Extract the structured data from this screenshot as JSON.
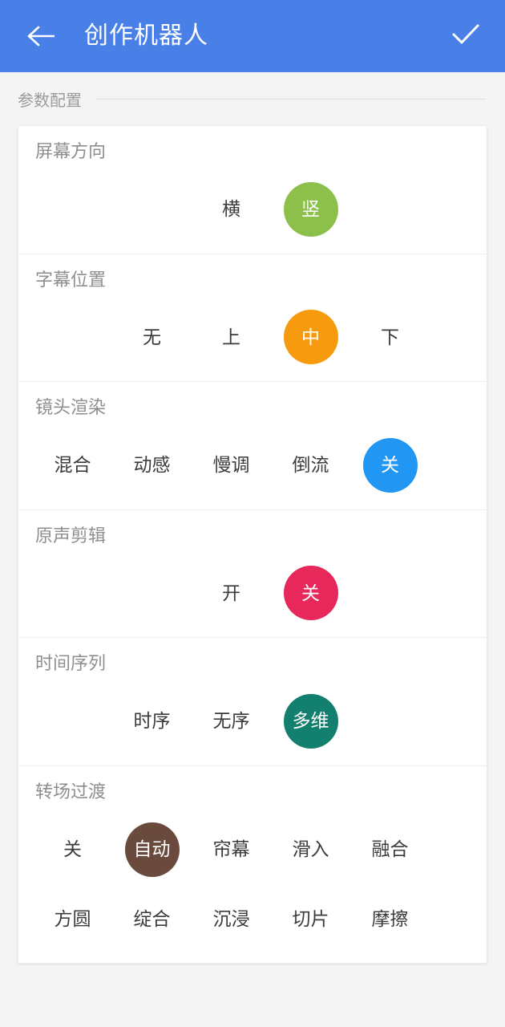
{
  "header": {
    "back_icon": "arrow-left-icon",
    "title": "创作机器人",
    "confirm_icon": "check-icon",
    "background": "#4880e8"
  },
  "group": {
    "label": "参数配置"
  },
  "sections": [
    {
      "title": "屏幕方向",
      "leading_blanks": 2,
      "color": "#8cc04a",
      "options": [
        {
          "label": "横",
          "selected": false
        },
        {
          "label": "竖",
          "selected": true
        }
      ]
    },
    {
      "title": "字幕位置",
      "leading_blanks": 1,
      "color": "#f89a0e",
      "options": [
        {
          "label": "无",
          "selected": false
        },
        {
          "label": "上",
          "selected": false
        },
        {
          "label": "中",
          "selected": true
        },
        {
          "label": "下",
          "selected": false
        }
      ]
    },
    {
      "title": "镜头渲染",
      "leading_blanks": 0,
      "color": "#2196f3",
      "options": [
        {
          "label": "混合",
          "selected": false
        },
        {
          "label": "动感",
          "selected": false
        },
        {
          "label": "慢调",
          "selected": false
        },
        {
          "label": "倒流",
          "selected": false
        },
        {
          "label": "关",
          "selected": true
        }
      ]
    },
    {
      "title": "原声剪辑",
      "leading_blanks": 2,
      "color": "#e8275a",
      "options": [
        {
          "label": "开",
          "selected": false
        },
        {
          "label": "关",
          "selected": true
        }
      ]
    },
    {
      "title": "时间序列",
      "leading_blanks": 1,
      "color": "#137f6e",
      "options": [
        {
          "label": "时序",
          "selected": false
        },
        {
          "label": "无序",
          "selected": false
        },
        {
          "label": "多维",
          "selected": true
        }
      ]
    },
    {
      "title": "转场过渡",
      "leading_blanks": 0,
      "color": "#6b4a3e",
      "options": [
        {
          "label": "关",
          "selected": false
        },
        {
          "label": "自动",
          "selected": true
        },
        {
          "label": "帘幕",
          "selected": false
        },
        {
          "label": "滑入",
          "selected": false
        },
        {
          "label": "融合",
          "selected": false
        },
        {
          "label": "方圆",
          "selected": false
        },
        {
          "label": "绽合",
          "selected": false
        },
        {
          "label": "沉浸",
          "selected": false
        },
        {
          "label": "切片",
          "selected": false
        },
        {
          "label": "摩擦",
          "selected": false
        }
      ],
      "per_row": 5
    }
  ]
}
